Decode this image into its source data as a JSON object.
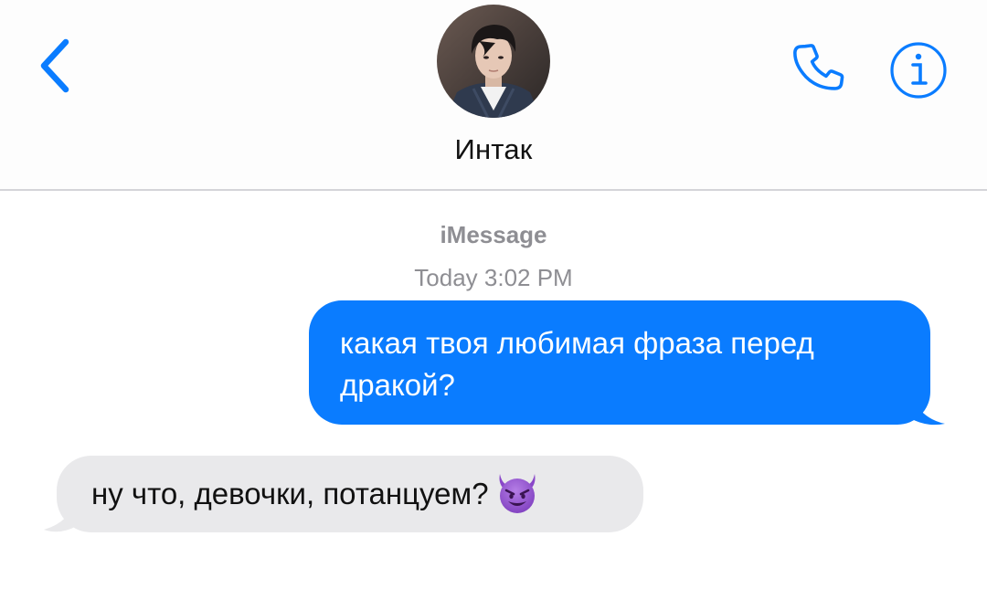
{
  "header": {
    "contact_name": "Интак",
    "back_icon": "chevron-left-icon",
    "call_icon": "phone-icon",
    "info_icon": "info-icon",
    "accent_color": "#0a7cff"
  },
  "conversation": {
    "service_label": "iMessage",
    "timestamp": "Today 3:02 PM",
    "messages": [
      {
        "direction": "outgoing",
        "text": "какая твоя любимая фраза перед дракой?"
      },
      {
        "direction": "incoming",
        "text": "ну что, девочки, потанцуем?",
        "emoji": "smiling-imp-emoji"
      }
    ]
  },
  "colors": {
    "outgoing_bubble": "#0a7cff",
    "incoming_bubble": "#e9e9eb",
    "meta_text": "#8e8e93"
  }
}
